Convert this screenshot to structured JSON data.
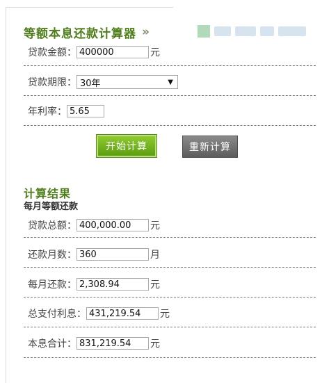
{
  "calculator": {
    "title": "等额本息还款计算器",
    "title_chevron": "»",
    "loan_amount": {
      "label": "贷款金额：",
      "value": "400000",
      "unit": "元"
    },
    "loan_term": {
      "label": "贷款期限：",
      "selected": "30年"
    },
    "rate": {
      "label": "年利率：",
      "value": "5.65"
    },
    "start_button": "开始计算",
    "reset_button": "重新计算"
  },
  "results": {
    "title": "计算结果",
    "subtitle": "每月等额还款",
    "total_loan": {
      "label": "贷款总额：",
      "value": "400,000.00",
      "unit": "元"
    },
    "months": {
      "label": "还款月数：",
      "value": "360",
      "unit": "月"
    },
    "monthly_payment": {
      "label": "每月还款：",
      "value": "2,308.94",
      "unit": "元"
    },
    "total_interest": {
      "label": "总支付利息：",
      "value": "431,219.54",
      "unit": "元"
    },
    "total_principal_interest": {
      "label": "本息合计：",
      "value": "831,219.54",
      "unit": "元"
    }
  },
  "colors": {
    "title_green": "#4e7d1a",
    "start_button": "#6aae18",
    "reset_button": "#6b6b6b"
  }
}
